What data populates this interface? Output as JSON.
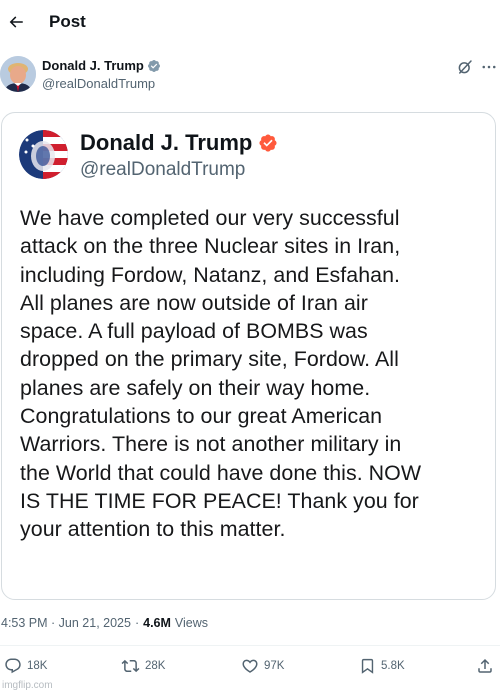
{
  "header": {
    "title": "Post",
    "back_icon": "arrow-left-icon"
  },
  "author": {
    "name": "Donald J. Trump",
    "handle": "@realDonaldTrump",
    "verified_color": "#829aab"
  },
  "quote_card": {
    "name": "Donald J. Trump",
    "handle": "@realDonaldTrump",
    "verified_color": "#ff5a3c",
    "text_lines": [
      "We have completed our very successful",
      "attack on the three Nuclear sites in Iran,",
      "including Fordow, Natanz, and Esfahan.",
      "All planes are now outside of Iran air",
      "space. A full payload of BOMBS was",
      "dropped on the primary site, Fordow. All",
      "planes are safely on their way home.",
      "Congratulations to our great American",
      "Warriors. There is not another military in",
      "the World that could have done this. NOW",
      "IS THE TIME FOR PEACE! Thank you for",
      "your attention to this matter."
    ]
  },
  "meta": {
    "timestamp": "4:53 PM · Jun 21, 2025",
    "separator": "·",
    "views_count": "4.6M",
    "views_label": "Views"
  },
  "actions": {
    "replies": "18K",
    "reposts": "28K",
    "likes": "97K",
    "bookmarks": "5.8K"
  },
  "watermark": "imgflip.com",
  "colors": {
    "text_primary": "#0f1419",
    "text_secondary": "#536471",
    "border": "#d6dce0"
  }
}
